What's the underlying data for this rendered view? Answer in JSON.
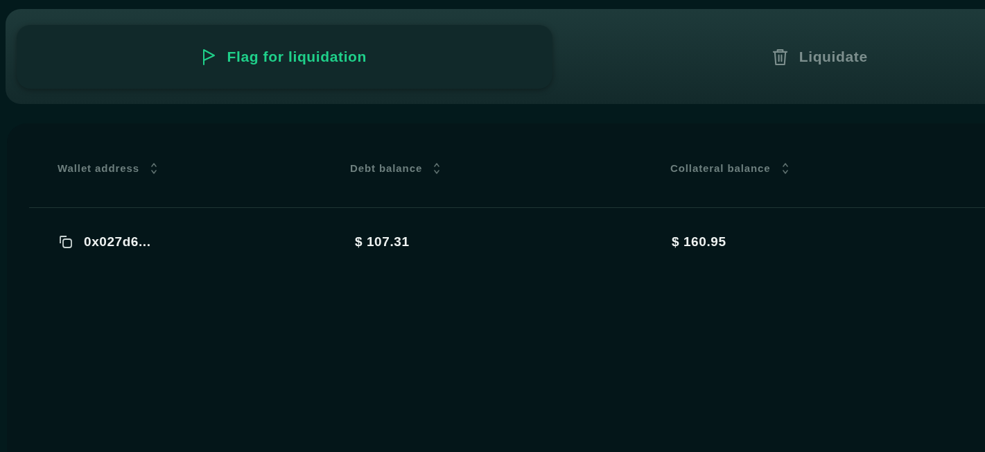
{
  "tabs": [
    {
      "label": "Flag for liquidation",
      "selected": true
    },
    {
      "label": "Liquidate",
      "selected": false
    }
  ],
  "table": {
    "columns": [
      "Wallet address",
      "Debt balance",
      "Collateral balance"
    ],
    "rows": [
      {
        "cells": [
          "0x027d6...",
          "$ 107.31",
          "$ 160.95"
        ]
      }
    ]
  }
}
